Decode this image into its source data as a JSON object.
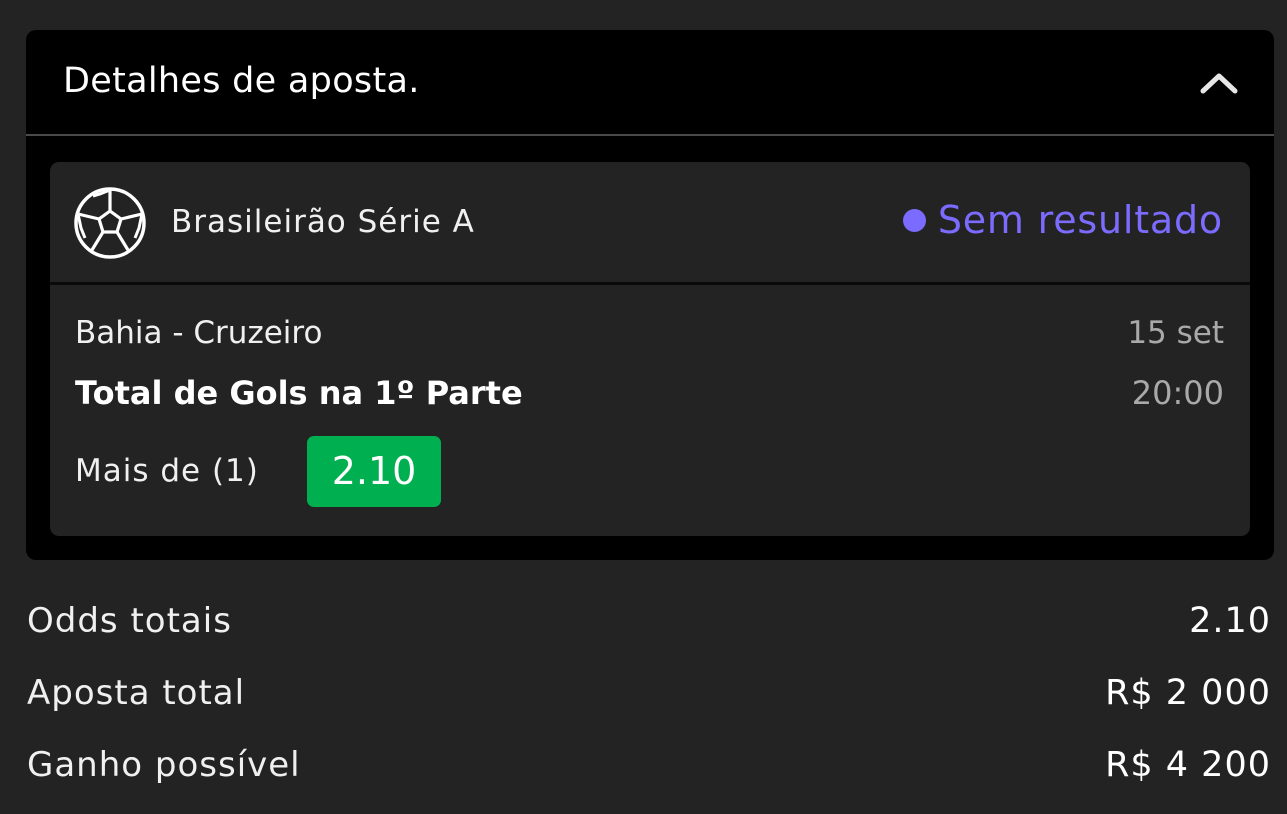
{
  "panel": {
    "title": "Detalhes de aposta.",
    "collapse_icon": "chevron-up-icon"
  },
  "bet_card": {
    "sport_icon": "soccer-ball-icon",
    "league": "Brasileirão Série A",
    "status": "Sem resultado",
    "status_color": "#7b6cff",
    "match": "Bahia - Cruzeiro",
    "date": "15 set",
    "market": "Total de Gols na 1º Parte",
    "time": "20:00",
    "selection": "Mais de (1)",
    "odds": "2.10",
    "odds_color": "#00b050"
  },
  "summary": {
    "rows": [
      {
        "label": "Odds totais",
        "value": "2.10"
      },
      {
        "label": "Aposta total",
        "value": "R$ 2 000"
      },
      {
        "label": "Ganho possível",
        "value": "R$ 4 200"
      }
    ]
  }
}
